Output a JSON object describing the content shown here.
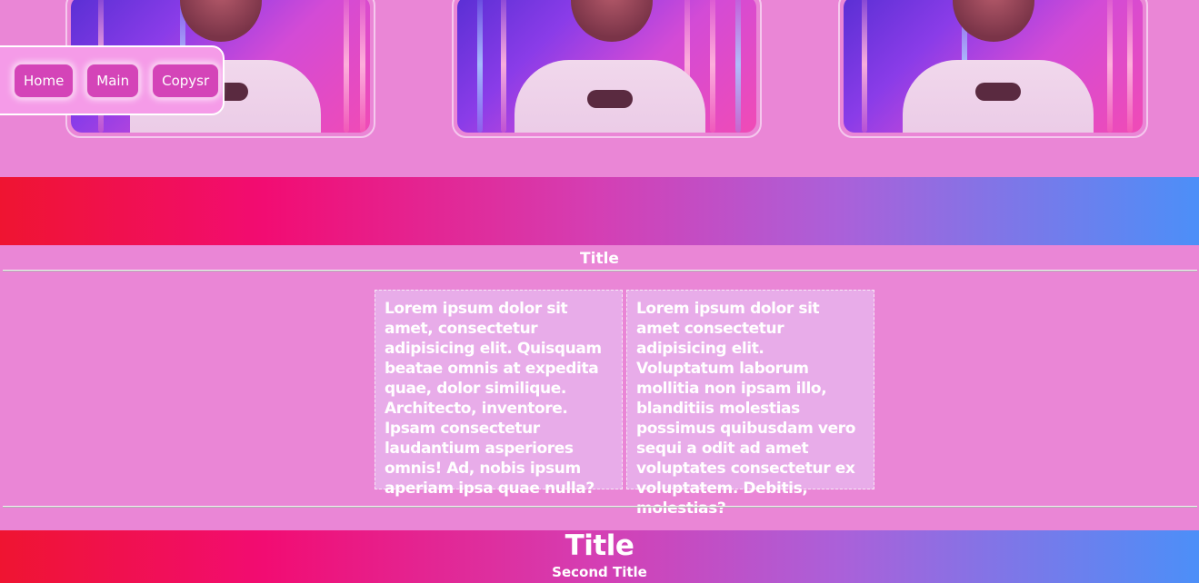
{
  "nav": {
    "items": [
      {
        "label": "Home"
      },
      {
        "label": "Main"
      },
      {
        "label": "Copysr"
      }
    ]
  },
  "gallery": {
    "photos": [
      {
        "alt": "neon portrait photo 1"
      },
      {
        "alt": "neon portrait photo 2"
      },
      {
        "alt": "neon portrait photo 3"
      }
    ]
  },
  "section": {
    "title": "Title",
    "columns": [
      {
        "text": "Lorem ipsum dolor sit amet, consectetur adipisicing elit. Quisquam beatae omnis at expedita quae, dolor similique. Architecto, inventore. Ipsam consectetur laudantium asperiores omnis! Ad, nobis ipsum aperiam ipsa quae nulla?"
      },
      {
        "text": "Lorem ipsum dolor sit amet consectetur adipisicing elit. Voluptatum laborum mollitia non ipsam illo, blanditiis molestias possimus quibusdam vero sequi a odit ad amet voluptates consectetur ex voluptatem. Debitis, molestias?"
      }
    ]
  },
  "footer": {
    "title": "Title",
    "subtitle": "Second Title"
  },
  "colors": {
    "background": "#ea86d6",
    "band_start": "#ef1431",
    "band_mid": "#d43fb4",
    "band_end": "#4c8ff8",
    "button": "#d444b8"
  }
}
